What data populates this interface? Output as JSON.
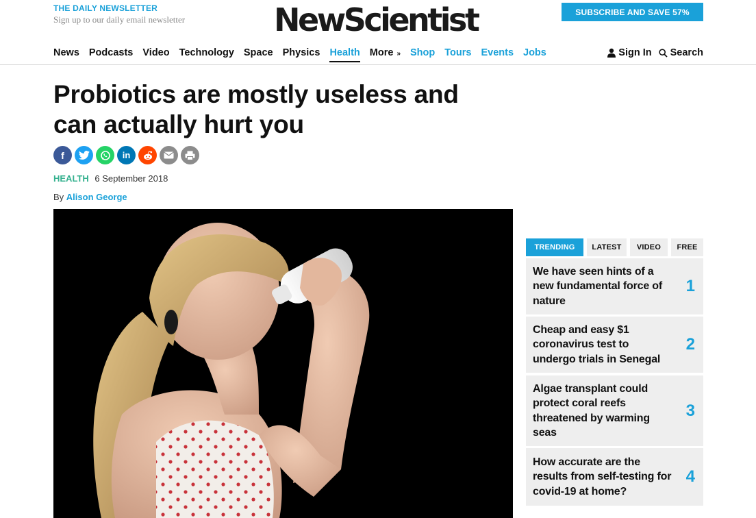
{
  "newsletter": {
    "title": "THE DAILY NEWSLETTER",
    "subtitle": "Sign up to our daily email newsletter"
  },
  "logo": "NewScientist",
  "subscribe_label": "SUBSCRIBE AND SAVE 57%",
  "nav": {
    "items": [
      "News",
      "Podcasts",
      "Video",
      "Technology",
      "Space",
      "Physics",
      "Health",
      "More",
      "Shop",
      "Tours",
      "Events",
      "Jobs"
    ],
    "more_chevron": "»",
    "sign_in": "Sign In",
    "search": "Search"
  },
  "article": {
    "headline": "Probiotics are mostly useless and can actually hurt you",
    "section": "HEALTH",
    "date": "6 September 2018",
    "by": "By",
    "author": "Alison George"
  },
  "share": {
    "icons": [
      "facebook-icon",
      "twitter-icon",
      "whatsapp-icon",
      "linkedin-icon",
      "reddit-icon",
      "email-icon",
      "print-icon"
    ],
    "colors": {
      "facebook": "#3b5998",
      "twitter": "#1da1f2",
      "whatsapp": "#25d366",
      "linkedin": "#0077b5",
      "reddit": "#ff4500",
      "email": "#8c8c8c",
      "print": "#8c8c8c"
    },
    "glyphs": {
      "facebook": "f",
      "twitter": "t",
      "whatsapp": "✆",
      "linkedin": "in",
      "reddit": "●",
      "email": "✉",
      "print": "⎙"
    }
  },
  "sidebar": {
    "tabs": [
      "TRENDING",
      "LATEST",
      "VIDEO",
      "FREE"
    ],
    "trending": [
      {
        "rank": "1",
        "title": "We have seen hints of a new fundamental force of nature"
      },
      {
        "rank": "2",
        "title": "Cheap and easy $1 coronavirus test to undergo trials in Senegal"
      },
      {
        "rank": "3",
        "title": "Algae transplant could protect coral reefs threatened by warming seas"
      },
      {
        "rank": "4",
        "title": "How accurate are the results from self-testing for covid-19 at home?"
      }
    ]
  },
  "colors": {
    "accent": "#1aa1d9",
    "section": "#35b18f",
    "text": "#111111",
    "panel": "#eeeeee"
  }
}
